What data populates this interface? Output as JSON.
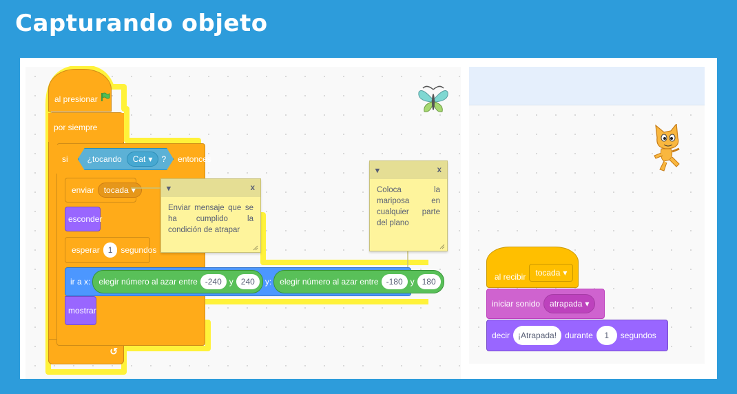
{
  "title": "Capturando objeto",
  "left_script": {
    "hat": "al presionar",
    "forever": "por siempre",
    "if_label": "si",
    "touching": "¿tocando",
    "touching_target": "Cat",
    "touching_q": "?",
    "then": "entonces",
    "send": "enviar",
    "send_msg": "tocada",
    "hide": "esconder",
    "wait": "esperar",
    "wait_value": "1",
    "wait_unit": "segundos",
    "goto_x": "ir a x:",
    "random1": "elegir número al azar entre",
    "r1_min": "-240",
    "and1": "y",
    "r1_max": "240",
    "goto_y": "y:",
    "random2": "elegir número al azar entre",
    "r2_min": "-180",
    "and2": "y",
    "r2_max": "180",
    "show": "mostrar"
  },
  "notes": [
    {
      "close": "x",
      "text": "Enviar  mensaje que se ha cumplido la condición de atrapar"
    },
    {
      "close": "x",
      "text": "Coloca  la  mariposa en cualquier   parte del  plano"
    }
  ],
  "right_script": {
    "hat": "al recibir",
    "hat_msg": "tocada",
    "sound": "iniciar sonido",
    "sound_name": "atrapada",
    "say": "decir",
    "say_text": "¡Atrapada!",
    "during": "durante",
    "say_secs": "1",
    "say_unit": "segundos"
  },
  "icons": {
    "flag": "green-flag-icon",
    "loop": "loop-arrow-icon",
    "sprite_left": "butterfly-sprite-icon",
    "sprite_right": "cat-sprite-icon"
  },
  "colors": {
    "background": "#2d9cdb",
    "control": "#ffab19",
    "looks": "#9966ff",
    "motion": "#4c97ff",
    "operators": "#59c059",
    "events": "#ffbf00",
    "sound": "#cf63cf",
    "sensing": "#5cb1d6",
    "note": "#fef49c"
  }
}
